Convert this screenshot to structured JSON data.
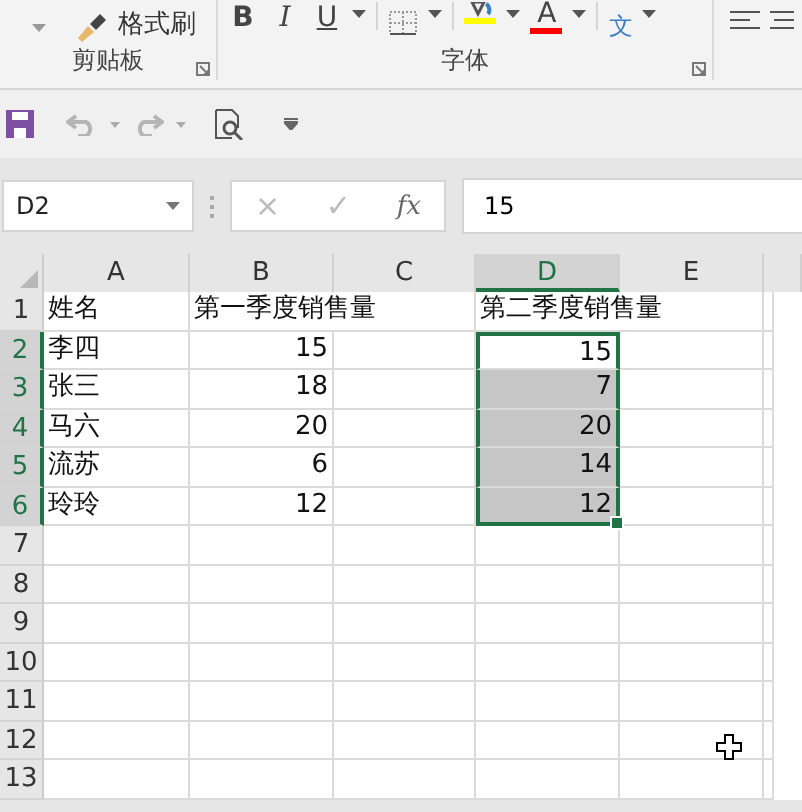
{
  "ribbon": {
    "groups": [
      {
        "kind": "clipboard",
        "label": "剪贴板",
        "format_painter": "格式刷"
      },
      {
        "kind": "font",
        "label": "字体",
        "bold": "B",
        "italic": "I",
        "underline": "U",
        "font_color_letter": "A",
        "phonetic": "文"
      }
    ]
  },
  "formula_bar": {
    "name_box": "D2",
    "cancel": "×",
    "enter": "✓",
    "function": "fx",
    "value": "15"
  },
  "columns": [
    {
      "label": "A",
      "selected": false
    },
    {
      "label": "B",
      "selected": false
    },
    {
      "label": "C",
      "selected": false
    },
    {
      "label": "D",
      "selected": true
    },
    {
      "label": "E",
      "selected": false
    }
  ],
  "rows": [
    {
      "number": "1",
      "selected": false,
      "cells": [
        {
          "text": "姓名",
          "kind": "text",
          "selected": false
        },
        {
          "text": "第一季度销售量",
          "kind": "text",
          "selected": false
        },
        {
          "kind": "text",
          "selected": false
        },
        {
          "text": "第二季度销售量",
          "kind": "text",
          "selected": false
        },
        {
          "kind": "text",
          "selected": false
        }
      ]
    },
    {
      "number": "2",
      "selected": true,
      "cells": [
        {
          "text": "李四",
          "kind": "text",
          "selected": false
        },
        {
          "text": "15",
          "kind": "number",
          "selected": false
        },
        {
          "kind": "text",
          "selected": false
        },
        {
          "text": "15",
          "kind": "number",
          "selected": true
        },
        {
          "kind": "text",
          "selected": false
        }
      ]
    },
    {
      "number": "3",
      "selected": true,
      "cells": [
        {
          "text": "张三",
          "kind": "text",
          "selected": false
        },
        {
          "text": "18",
          "kind": "number",
          "selected": false
        },
        {
          "kind": "text",
          "selected": false
        },
        {
          "text": "7",
          "kind": "number",
          "selected": true
        },
        {
          "kind": "text",
          "selected": false
        }
      ]
    },
    {
      "number": "4",
      "selected": true,
      "cells": [
        {
          "text": "马六",
          "kind": "text",
          "selected": false
        },
        {
          "text": "20",
          "kind": "number",
          "selected": false
        },
        {
          "kind": "text",
          "selected": false
        },
        {
          "text": "20",
          "kind": "number",
          "selected": true
        },
        {
          "kind": "text",
          "selected": false
        }
      ]
    },
    {
      "number": "5",
      "selected": true,
      "cells": [
        {
          "text": "流苏",
          "kind": "text",
          "selected": false
        },
        {
          "text": "6",
          "kind": "number",
          "selected": false
        },
        {
          "kind": "text",
          "selected": false
        },
        {
          "text": "14",
          "kind": "number",
          "selected": true
        },
        {
          "kind": "text",
          "selected": false
        }
      ]
    },
    {
      "number": "6",
      "selected": true,
      "cells": [
        {
          "text": "玲玲",
          "kind": "text",
          "selected": false
        },
        {
          "text": "12",
          "kind": "number",
          "selected": false
        },
        {
          "kind": "text",
          "selected": false
        },
        {
          "text": "12",
          "kind": "number",
          "selected": true
        },
        {
          "kind": "text",
          "selected": false
        }
      ]
    },
    {
      "number": "7",
      "selected": false
    },
    {
      "number": "8",
      "selected": false
    },
    {
      "number": "9",
      "selected": false
    },
    {
      "number": "10",
      "selected": false
    },
    {
      "number": "11",
      "selected": false
    },
    {
      "number": "12",
      "selected": false
    },
    {
      "number": "13",
      "selected": false
    }
  ]
}
